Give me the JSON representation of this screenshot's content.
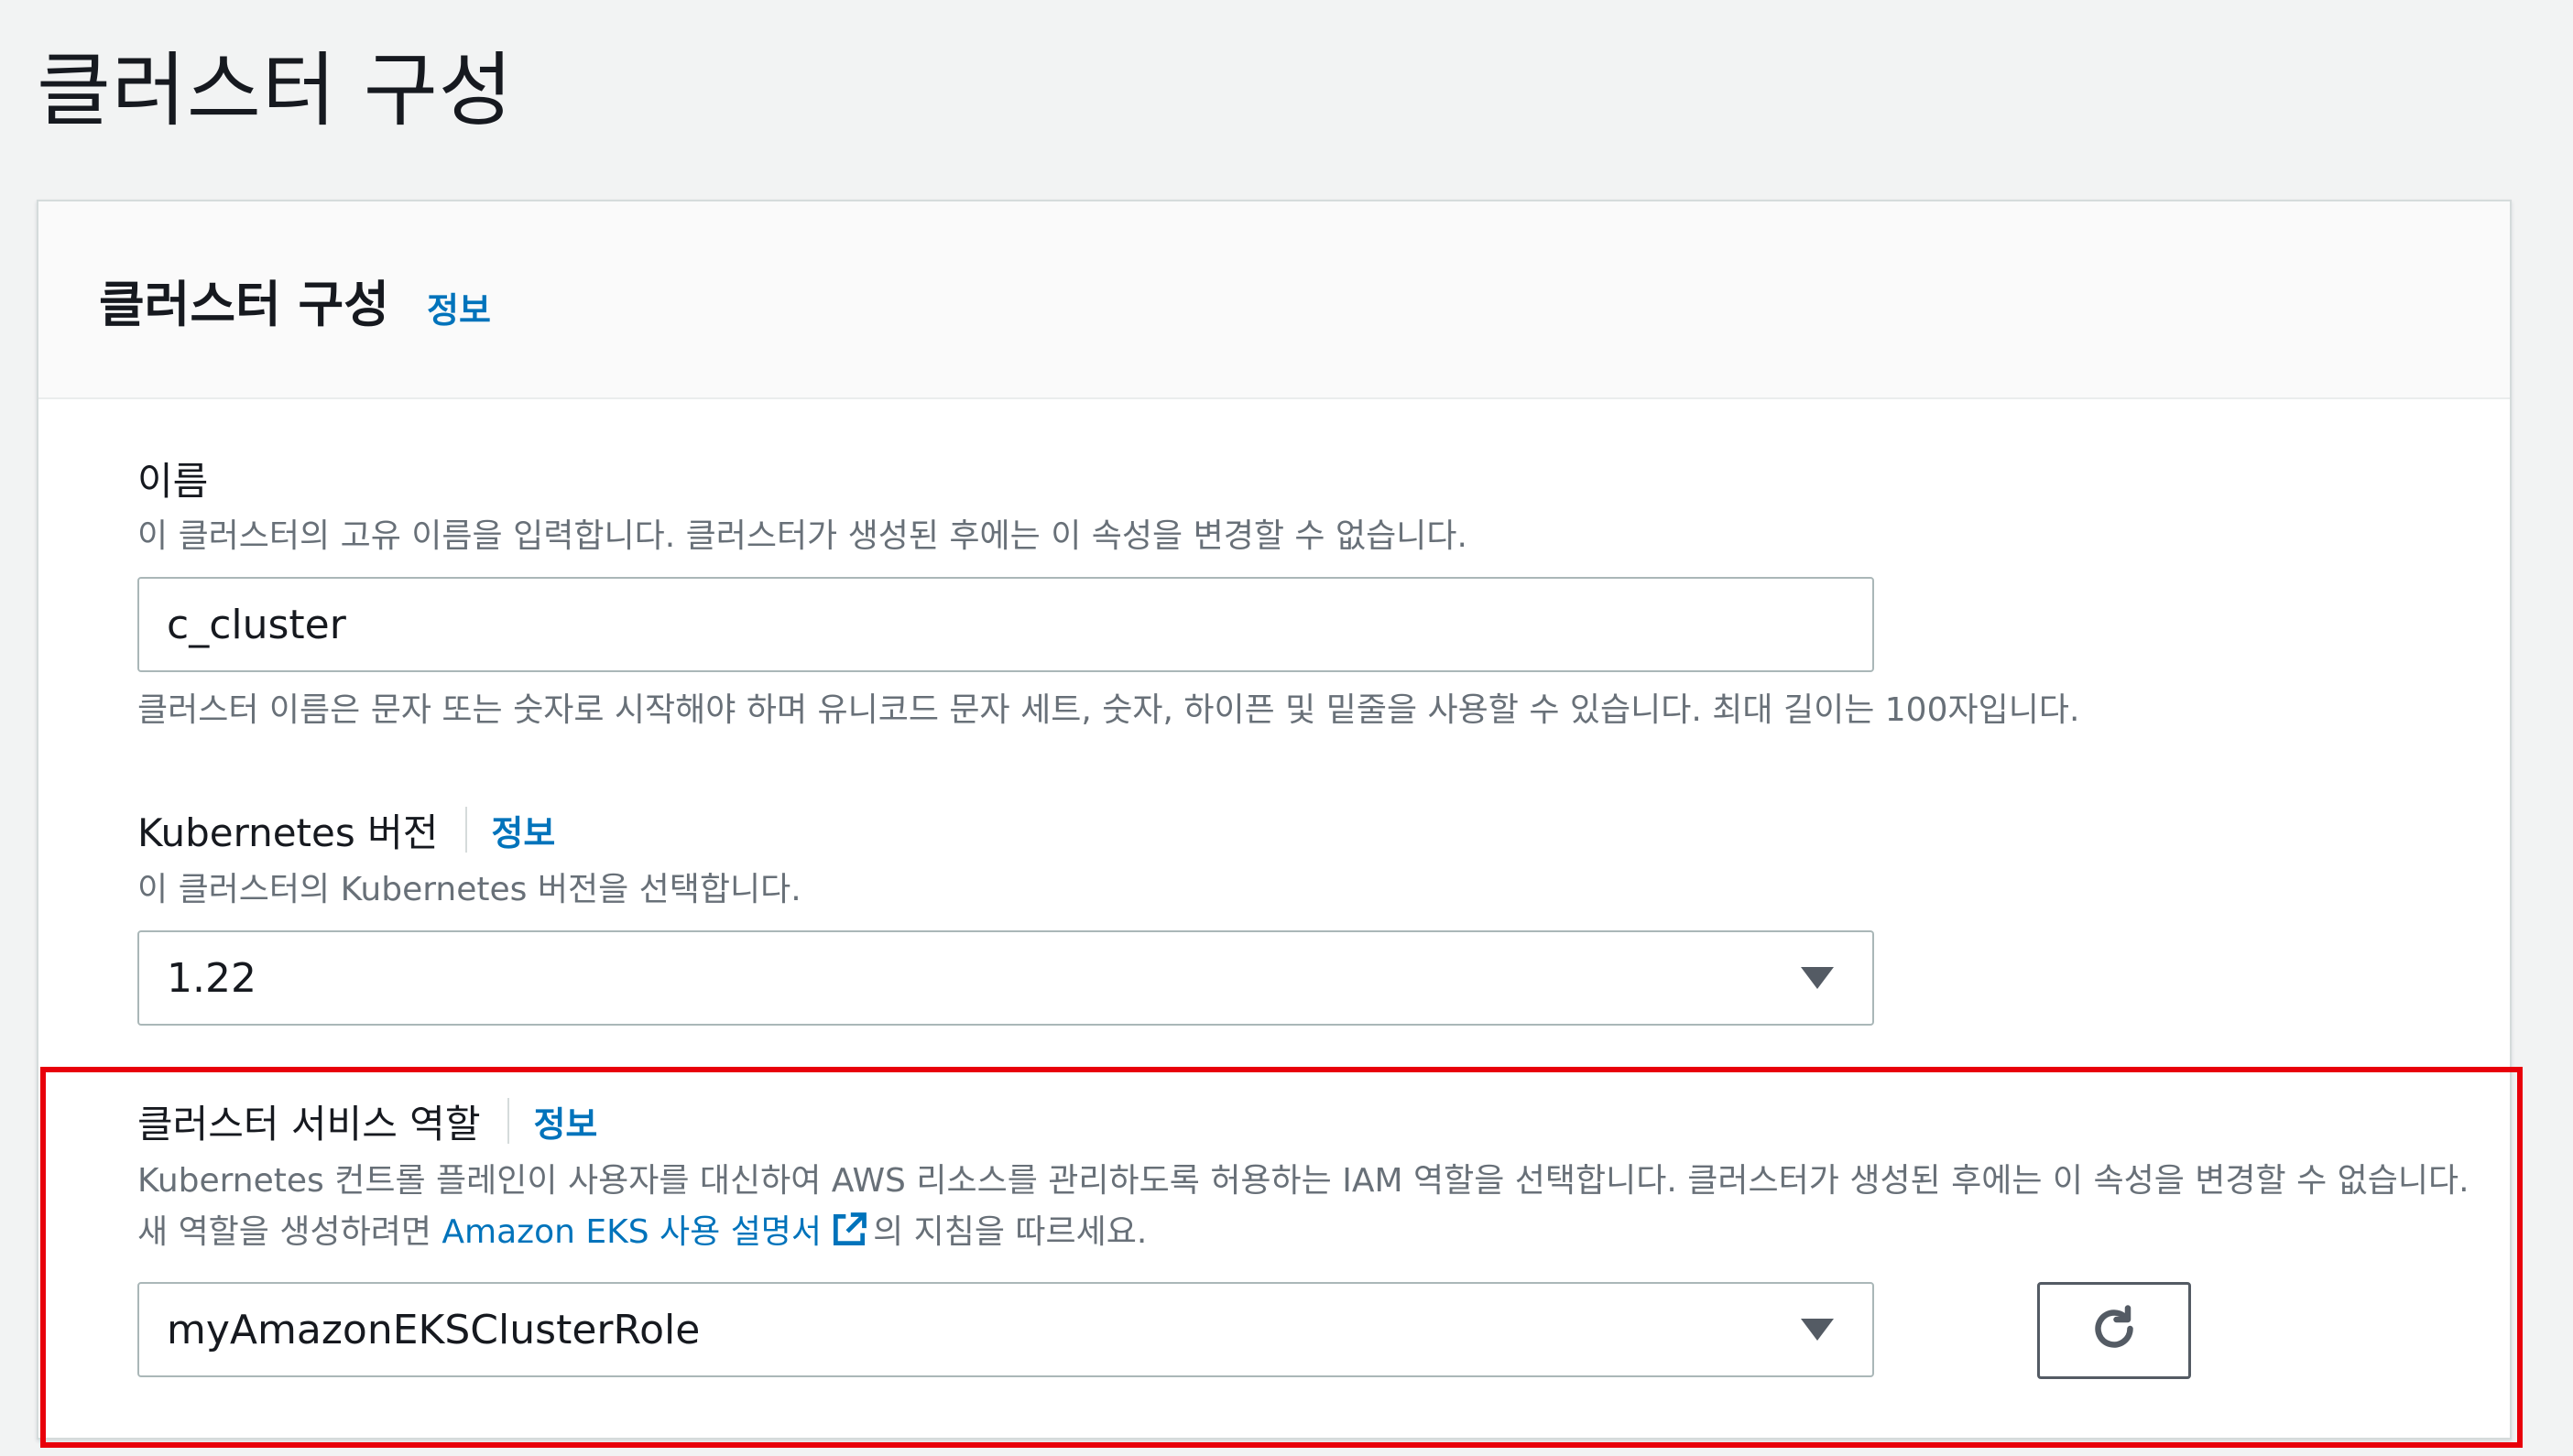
{
  "page_title": "클러스터 구성",
  "panel": {
    "title": "클러스터 구성",
    "info_label": "정보"
  },
  "name_field": {
    "label": "이름",
    "description": "이 클러스터의 고유 이름을 입력합니다. 클러스터가 생성된 후에는 이 속성을 변경할 수 없습니다.",
    "value": "c_cluster",
    "constraint": "클러스터 이름은 문자 또는 숫자로 시작해야 하며 유니코드 문자 세트, 숫자, 하이픈 및 밑줄을 사용할 수 있습니다. 최대 길이는 100자입니다."
  },
  "k8s_version_field": {
    "label": "Kubernetes 버전",
    "info_label": "정보",
    "description": "이 클러스터의 Kubernetes 버전을 선택합니다.",
    "selected": "1.22"
  },
  "service_role_field": {
    "label": "클러스터 서비스 역할",
    "info_label": "정보",
    "description_part1": "Kubernetes 컨트롤 플레인이 사용자를 대신하여 AWS 리소스를 관리하도록 허용하는 IAM 역할을 선택합니다. 클러스터가 생성된 후에는 이 속성을 변경할 수 없습니다. 새 역할을 생성하려면 ",
    "link_text": "Amazon EKS 사용 설명서",
    "description_part2": "의 지침을 따르세요.",
    "selected": "myAmazonEKSClusterRole"
  },
  "colors": {
    "link": "#0073bb",
    "highlight": "#e8000b",
    "text": "#16191f",
    "muted": "#687078"
  },
  "icons": {
    "external_link": "external-link-icon",
    "dropdown": "caret-down-icon",
    "refresh": "refresh-icon"
  }
}
